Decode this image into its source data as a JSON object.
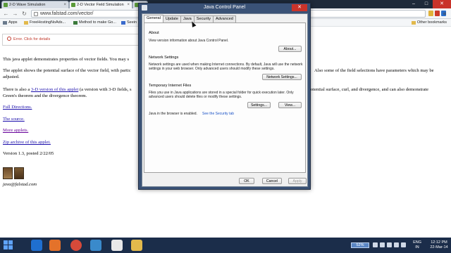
{
  "browser": {
    "tabs": [
      {
        "label": "2-D Wave Simulation"
      },
      {
        "label": "2-D Vector Field Simulation"
      },
      {
        "label": "B"
      }
    ],
    "url": "www.falstad.com/vector/",
    "bookmarks": [
      {
        "label": "Apps"
      },
      {
        "label": "FreeHostingNoAds..."
      },
      {
        "label": "Method to make Go..."
      },
      {
        "label": "Seein"
      }
    ],
    "other_bookmarks": "Other bookmarks"
  },
  "page": {
    "applet_error": "Error. Click for details",
    "para1": "This java applet demonstrates properties of vector fields. You may s",
    "para2_line1": "The applet shows the potential surface of the vector field, with partic",
    "para2_line1_right": "Also some of the field selections have parameters which may be",
    "para2_line2": "adjusted.",
    "para3_start": "There is also a ",
    "para3_link": "3-D version of this applet",
    "para3_rest": " (a version with 3-D fields, s",
    "para3_right": "otential surface, curl, and divergence, and can also demonstrate",
    "para3_line2": "Green's theorem and the divergence theorem.",
    "links": [
      {
        "label": "Full Directions."
      },
      {
        "label": "The source."
      },
      {
        "label": "More applets."
      },
      {
        "label": "Zip archive of this applet."
      }
    ],
    "version": "Version 1.3, posted 2/22/05",
    "email": "java@falstad.com"
  },
  "dialog": {
    "title": "Java Control Panel",
    "tabs": [
      {
        "label": "General",
        "active": true
      },
      {
        "label": "Update"
      },
      {
        "label": "Java"
      },
      {
        "label": "Security"
      },
      {
        "label": "Advanced"
      }
    ],
    "about": {
      "heading": "About",
      "text": "View version information about Java Control Panel.",
      "button": "About..."
    },
    "network": {
      "heading": "Network Settings",
      "text1": "Network settings are used when making Internet connections. By default, Java will use the network",
      "text2": "settings in your web browser. Only advanced users should modify these settings.",
      "button": "Network Settings..."
    },
    "temp": {
      "heading": "Temporary Internet Files",
      "text1": "Files you use in Java applications are stored in a special folder for quick execution later. Only",
      "text2": "advanced users should delete files or modify these settings.",
      "settings_button": "Settings...",
      "view_button": "View..."
    },
    "browser_status": "Java in the browser is enabled.",
    "security_link": "See the Security tab",
    "footer": {
      "ok": "OK",
      "cancel": "Cancel",
      "apply": "Apply"
    }
  },
  "taskbar": {
    "battery": "52%",
    "lang_top": "ENG",
    "lang_bottom": "IN",
    "time": "12:12 PM",
    "date": "22-Mar-14"
  }
}
